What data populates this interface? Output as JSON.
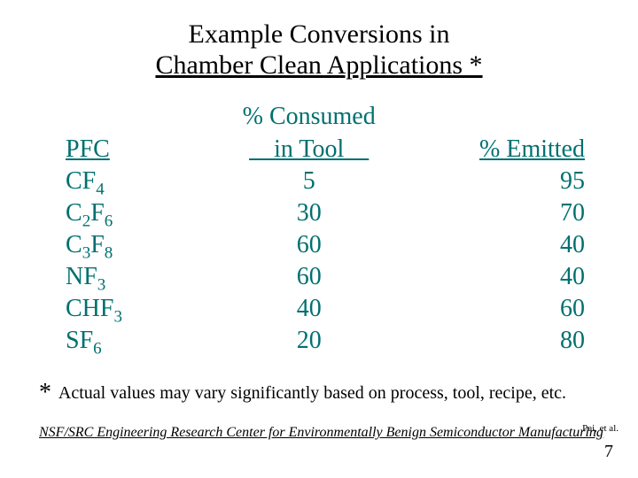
{
  "title": {
    "line1": "Example Conversions in",
    "line2": "Chamber Clean Applications *"
  },
  "headers": {
    "pfc": "PFC",
    "consumed_l1": "% Consumed",
    "consumed_l2": "    in Tool    ",
    "emitted": "% Emitted"
  },
  "chart_data": {
    "type": "table",
    "columns": [
      "PFC",
      "% Consumed in Tool",
      "% Emitted"
    ],
    "rows": [
      {
        "pfc_base": "CF",
        "pfc_sub": "4",
        "consumed": "5",
        "emitted": "95"
      },
      {
        "pfc_base": "C",
        "pfc_mid": "2",
        "pfc_base2": "F",
        "pfc_sub": "6",
        "consumed": "30",
        "emitted": "70"
      },
      {
        "pfc_base": "C",
        "pfc_mid": "3",
        "pfc_base2": "F",
        "pfc_sub": "8",
        "consumed": "60",
        "emitted": "40"
      },
      {
        "pfc_base": "NF",
        "pfc_sub": "3",
        "consumed": "60",
        "emitted": "40"
      },
      {
        "pfc_base": "CHF",
        "pfc_sub": "3",
        "consumed": "40",
        "emitted": "60"
      },
      {
        "pfc_base": "SF",
        "pfc_sub": "6",
        "consumed": "20",
        "emitted": "80"
      }
    ]
  },
  "footnote": {
    "star": "*",
    "text": "Actual values may vary significantly based on process, tool, recipe, etc."
  },
  "center_credit": "NSF/SRC Engineering Research Center for Environmentally Benign Semiconductor Manufacturing",
  "cite": "Pei, et al.",
  "page_number": "7"
}
